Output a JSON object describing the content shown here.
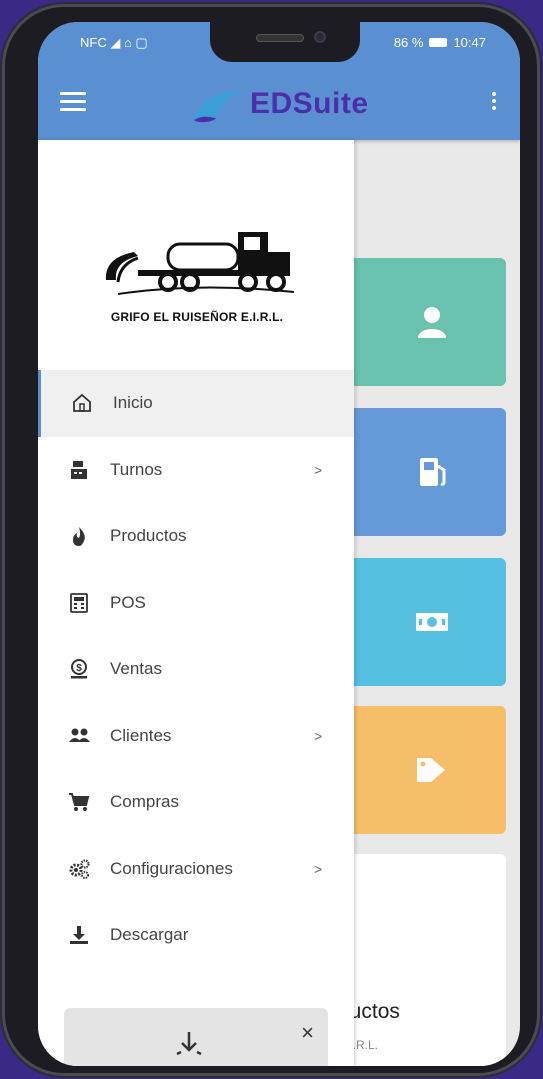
{
  "status": {
    "left_icons": "NFC ◢ ⌂ ▢",
    "battery": "86 %",
    "time": "10:47"
  },
  "app": {
    "brand": "EDSuite"
  },
  "company": {
    "name": "GRIFO EL RUISEÑOR E.I.R.L."
  },
  "menu": {
    "items": [
      {
        "label": "Inicio",
        "icon": "home-icon",
        "active": true
      },
      {
        "label": "Turnos",
        "icon": "cash-register-icon",
        "submenu": true
      },
      {
        "label": "Productos",
        "icon": "flame-icon"
      },
      {
        "label": "POS",
        "icon": "calculator-icon"
      },
      {
        "label": "Ventas",
        "icon": "money-icon"
      },
      {
        "label": "Clientes",
        "icon": "users-icon",
        "submenu": true
      },
      {
        "label": "Compras",
        "icon": "cart-icon"
      },
      {
        "label": "Configuraciones",
        "icon": "gears-icon",
        "submenu": true
      },
      {
        "label": "Descargar",
        "icon": "download-icon"
      }
    ],
    "chevron": ">"
  },
  "cards": [
    {
      "icon": "user-icon",
      "color": "#69c1ae"
    },
    {
      "icon": "fuel-icon",
      "color": "#6599d8"
    },
    {
      "icon": "money-bill-icon",
      "color": "#56c0e2"
    },
    {
      "icon": "tag-icon",
      "color": "#f7be6a"
    }
  ],
  "bottom_card": {
    "title": "ductos",
    "subtitle": "E.I.R.L."
  },
  "toast": {
    "close": "×"
  },
  "colors": {
    "accent": "#5a8fd2",
    "brand": "#4a2fa8",
    "background": "#3a2a86"
  }
}
